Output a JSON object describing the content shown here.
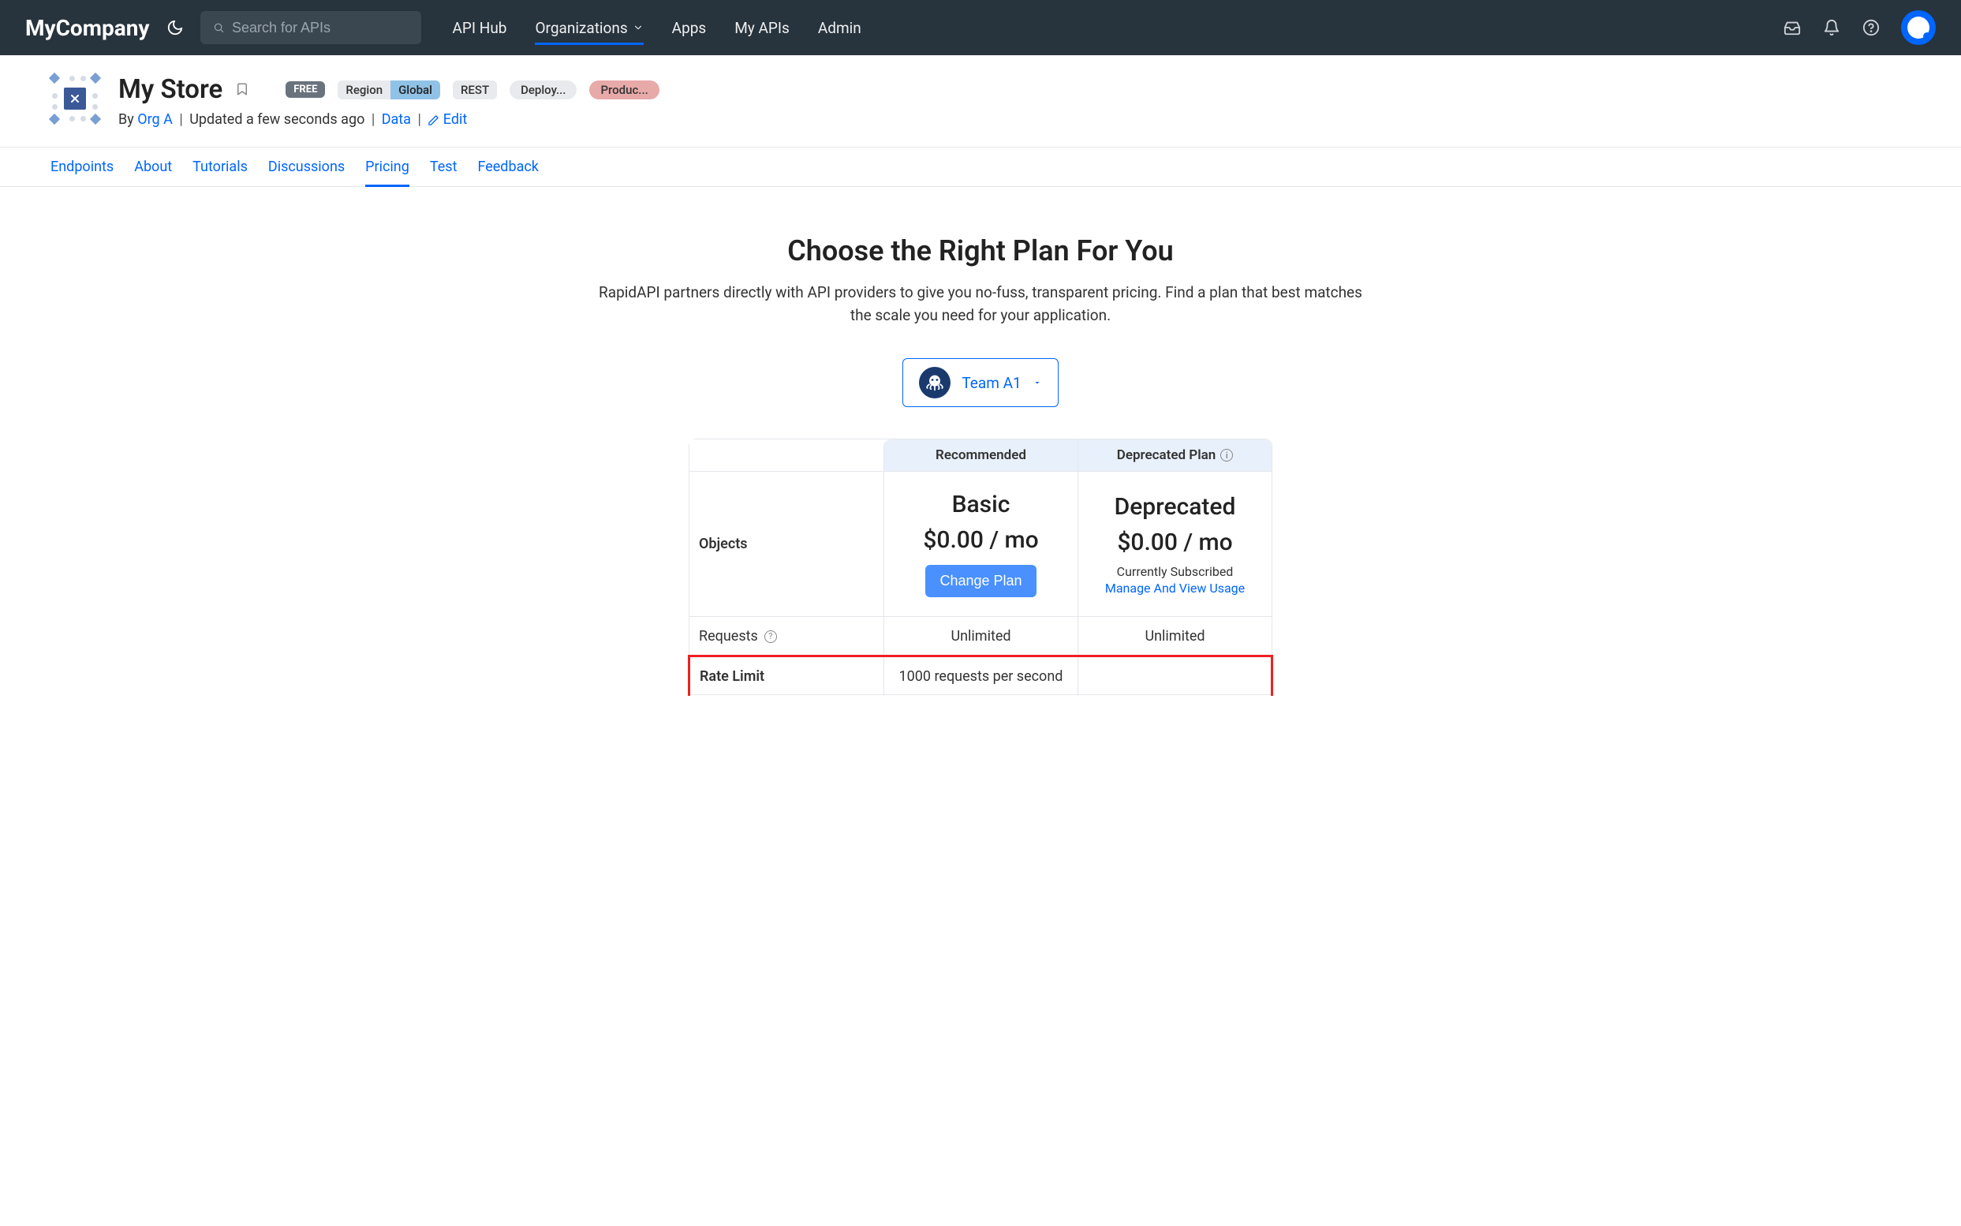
{
  "header": {
    "logo": "MyCompany",
    "search_placeholder": "Search for APIs",
    "nav": {
      "api_hub": "API Hub",
      "organizations": "Organizations",
      "apps": "Apps",
      "my_apis": "My APIs",
      "admin": "Admin"
    }
  },
  "api": {
    "title": "My Store",
    "badges": {
      "free": "FREE",
      "region": "Region",
      "global": "Global",
      "rest": "REST",
      "deploy": "Deploy...",
      "product": "Produc..."
    },
    "meta": {
      "by": "By",
      "org": "Org A",
      "updated": "Updated a few seconds ago",
      "data": "Data",
      "edit": "Edit"
    }
  },
  "tabs": {
    "endpoints": "Endpoints",
    "about": "About",
    "tutorials": "Tutorials",
    "discussions": "Discussions",
    "pricing": "Pricing",
    "test": "Test",
    "feedback": "Feedback"
  },
  "pricing": {
    "heading": "Choose the Right Plan For You",
    "subheading": "RapidAPI partners directly with API providers to give you no-fuss, transparent pricing. Find a plan that best matches the scale you need for your application.",
    "team": "Team A1",
    "columns": {
      "objects": "Objects",
      "recommended": "Recommended",
      "deprecated_header": "Deprecated Plan"
    },
    "plans": {
      "basic": {
        "name": "Basic",
        "price": "$0.00 / mo",
        "cta": "Change Plan"
      },
      "deprecated": {
        "name": "Deprecated",
        "price": "$0.00 / mo",
        "status": "Currently Subscribed",
        "manage": "Manage And View Usage"
      }
    },
    "rows": {
      "requests": "Requests",
      "requests_basic": "Unlimited",
      "requests_deprecated": "Unlimited",
      "rate_limit": "Rate Limit",
      "rate_limit_basic": "1000 requests per second",
      "rate_limit_deprecated": ""
    }
  }
}
